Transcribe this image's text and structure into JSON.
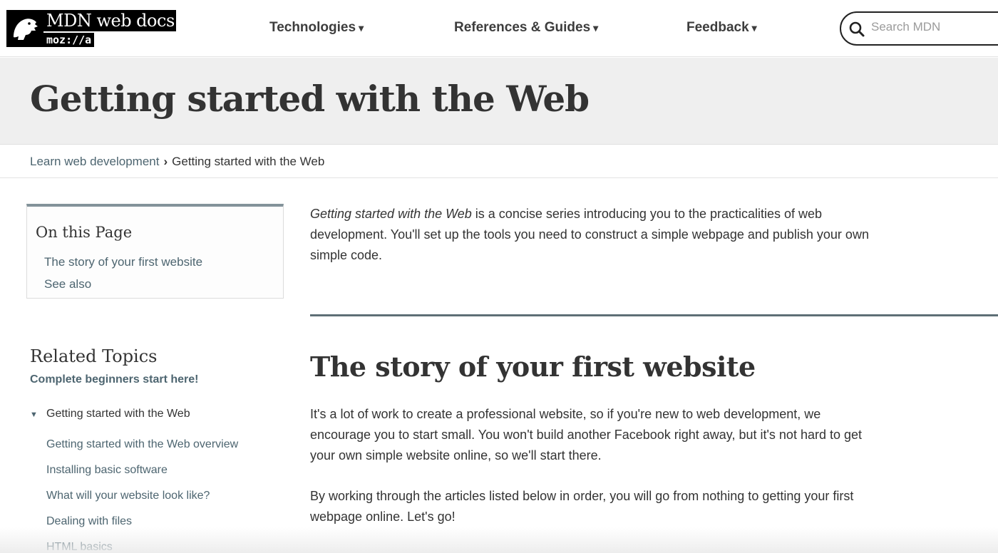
{
  "header": {
    "logo_title": "MDN web docs",
    "logo_sub": "moz://a",
    "nav": [
      {
        "label": "Technologies",
        "caret": "▾"
      },
      {
        "label": "References & Guides",
        "caret": "▾"
      },
      {
        "label": "Feedback",
        "caret": "▾"
      }
    ],
    "search_placeholder": "Search MDN"
  },
  "page": {
    "title": "Getting started with the Web"
  },
  "breadcrumb": {
    "parent": "Learn web development",
    "separator": "›",
    "current": "Getting started with the Web"
  },
  "toc": {
    "title": "On this Page",
    "links": [
      "The story of your first website",
      "See also"
    ]
  },
  "related": {
    "title": "Related Topics",
    "subtitle": "Complete beginners start here!",
    "group_label": "Getting started with the Web",
    "links": [
      "Getting started with the Web overview",
      "Installing basic software",
      "What will your website look like?",
      "Dealing with files",
      "HTML basics"
    ]
  },
  "main": {
    "intro_emph": "Getting started with the Web",
    "intro_rest": " is a concise series introducing you to the practicalities of web development. You'll set up the tools you need to construct a simple webpage and publish your own simple code.",
    "section_title": "The story of your first website",
    "paragraphs": [
      "It's a lot of work to create a professional website, so if you're new to web development, we encourage you to start small. You won't build another Facebook right away, but it's not hard to get your own simple website online, so we'll start there.",
      "By working through the articles listed below in order, you will go from nothing to getting your first webpage online. Let's go!"
    ]
  },
  "colors": {
    "link": "#4d6570",
    "text": "#333333",
    "band": "#efefef",
    "rule": "#5e6f76"
  }
}
